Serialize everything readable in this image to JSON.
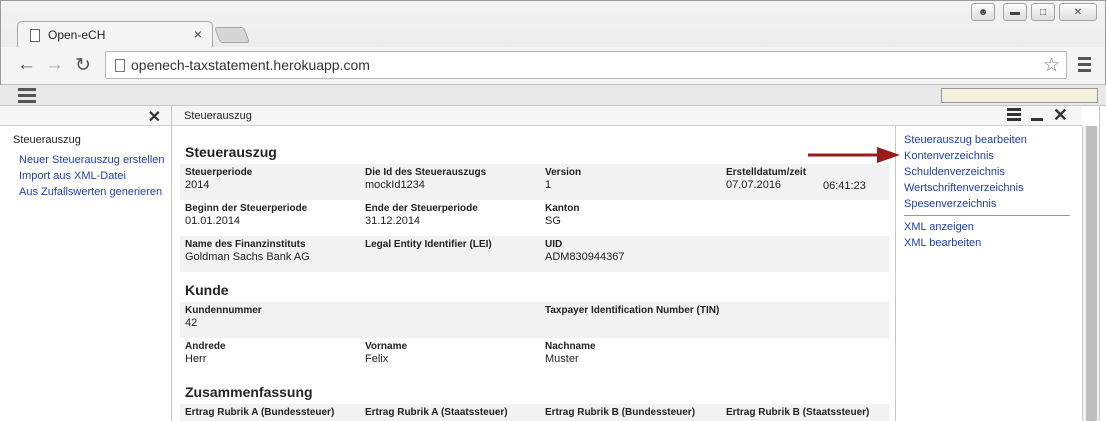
{
  "browser": {
    "tab_title": "Open-eCH",
    "tab_close": "×",
    "url": "openech-taxstatement.herokuapp.com",
    "icons": [
      "back-icon",
      "forward-icon",
      "reload-icon",
      "star-icon",
      "menu-icon",
      "user-icon",
      "minimize-icon",
      "maximize-icon",
      "close-icon"
    ]
  },
  "left_panel": {
    "close": "✕",
    "title": "Steuerauszug",
    "links": [
      "Neuer Steuerauszug erstellen",
      "Import aus XML-Datei",
      "Aus Zufallswerten generieren"
    ]
  },
  "main_panel": {
    "header_title": "Steuerauszug",
    "close": "✕",
    "sections": [
      {
        "title": "Steuerauszug",
        "rows": [
          [
            {
              "label": "Steuerperiode",
              "value": "2014"
            },
            {
              "label": "Die Id des Steuerauszugs",
              "value": "mockId1234"
            },
            {
              "label": "Version",
              "value": "1"
            },
            {
              "label": "Erstelldatum/zeit",
              "value": "07.07.2016",
              "value2": "06:41:23"
            }
          ],
          [
            {
              "label": "Beginn der Steuerperiode",
              "value": "01.01.2014"
            },
            {
              "label": "Ende der Steuerperiode",
              "value": "31.12.2014"
            },
            {
              "label": "Kanton",
              "value": "SG"
            }
          ],
          [
            {
              "label": "Name des Finanzinstituts",
              "value": "Goldman Sachs Bank AG"
            },
            {
              "label": "Legal Entity Identifier (LEI)",
              "value": ""
            },
            {
              "label": "UID",
              "value": "ADM830944367"
            }
          ]
        ]
      },
      {
        "title": "Kunde",
        "rows": [
          [
            {
              "label": "Kundennummer",
              "value": "42"
            },
            {
              "label": "Taxpayer Identification Number (TIN)",
              "value": ""
            }
          ],
          [
            {
              "label": "Andrede",
              "value": "Herr"
            },
            {
              "label": "Vorname",
              "value": "Felix"
            },
            {
              "label": "Nachname",
              "value": "Muster"
            }
          ]
        ]
      },
      {
        "title": "Zusammenfassung",
        "rows": [
          [
            {
              "label": "Ertrag Rubrik A (Bundessteuer)",
              "value": ""
            },
            {
              "label": "Ertrag Rubrik A (Staatssteuer)",
              "value": ""
            },
            {
              "label": "Ertrag Rubrik B (Bundessteuer)",
              "value": ""
            },
            {
              "label": "Ertrag Rubrik B (Staatssteuer)",
              "value": ""
            }
          ]
        ]
      }
    ]
  },
  "actions": {
    "group1": [
      "Steuerauszug bearbeiten",
      "Kontenverzeichnis",
      "Schuldenverzeichnis",
      "Wertschriftenverzeichnis",
      "Spesenverzeichnis"
    ],
    "group2": [
      "XML anzeigen",
      "XML bearbeiten"
    ]
  },
  "colors": {
    "link": "#1f3fb0",
    "arrow": "#9b1b1b"
  }
}
